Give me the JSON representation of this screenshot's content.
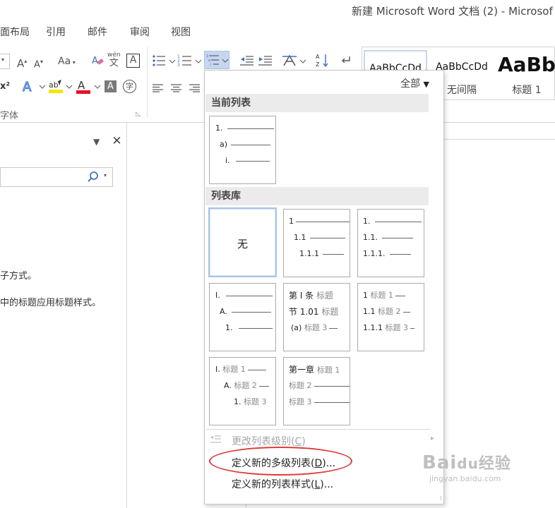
{
  "window": {
    "title": "新建 Microsoft Word 文档 (2) - Microsof"
  },
  "ribbon_tabs": [
    "面布局",
    "引用",
    "邮件",
    "审阅",
    "视图"
  ],
  "ribbon": {
    "font_group_label": "字体",
    "font_size_buttons": {
      "grow": "A",
      "shrink": "A",
      "change_case": "Aa"
    },
    "phonetic_guide": "wén",
    "border_char": "A",
    "font_color_letter": "A",
    "highlight_letter": "ab",
    "superscript_label": "x²",
    "enclose_char": "字",
    "accent_colors": {
      "highlight": "#f5e600",
      "font_color": "#e81123",
      "list_active": "#c5d6ee"
    }
  },
  "styles_gallery": {
    "items": [
      {
        "sample": "AaBbCcDd",
        "name": ""
      },
      {
        "sample": "AaBbCcDd",
        "name": "无间隔"
      },
      {
        "sample": "AaBb",
        "name": "标题 1"
      }
    ]
  },
  "left_pane": {
    "text_line_1": "子方式。",
    "text_line_2": "中的标题应用标题样式。"
  },
  "dropdown": {
    "filter_label": "全部",
    "current_list_header": "当前列表",
    "current_list": {
      "line1": "1.",
      "line2": "a)",
      "line3": "i."
    },
    "library_header": "列表库",
    "none_label": "无",
    "tiles": [
      {
        "l1": "1",
        "l2": "1.1",
        "l3": "1.1.1"
      },
      {
        "l1": "1.",
        "l2": "1.1.",
        "l3": "1.1.1."
      },
      {
        "l1": "I.",
        "l2": "A.",
        "l3": "1."
      },
      {
        "l1a": "第 I 条",
        "l1b": "标题",
        "l2a": "节 1.01",
        "l2b": "标题",
        "l3a": "(a)",
        "l3b": "标题 3"
      },
      {
        "l1a": "1",
        "l1b": "标题 1",
        "l2a": "1.1",
        "l2b": "标题 2",
        "l3a": "1.1.1",
        "l3b": "标题 3"
      },
      {
        "l1a": "I.",
        "l1b": "标题 1",
        "l2a": "A.",
        "l2b": "标题 2",
        "l3a": "1.",
        "l3b": "标题 3"
      },
      {
        "l1a": "第一章",
        "l1b": "标题 1",
        "l2a": "",
        "l2b": "标题 2",
        "l3a": "",
        "l3b": "标题 3"
      }
    ],
    "menu": {
      "change_level": "更改列表级别(",
      "change_level_key": "C",
      "change_level_end": ")",
      "define_multilevel": "定义新的多级列表(",
      "define_multilevel_key": "D",
      "define_multilevel_end": ")...",
      "define_style": "定义新的列表样式(",
      "define_style_key": "L",
      "define_style_end": ")..."
    }
  },
  "watermark": {
    "main": "Bai",
    "paw": "du",
    "cn": "经验",
    "sub": "jingyan.baidu.com"
  }
}
